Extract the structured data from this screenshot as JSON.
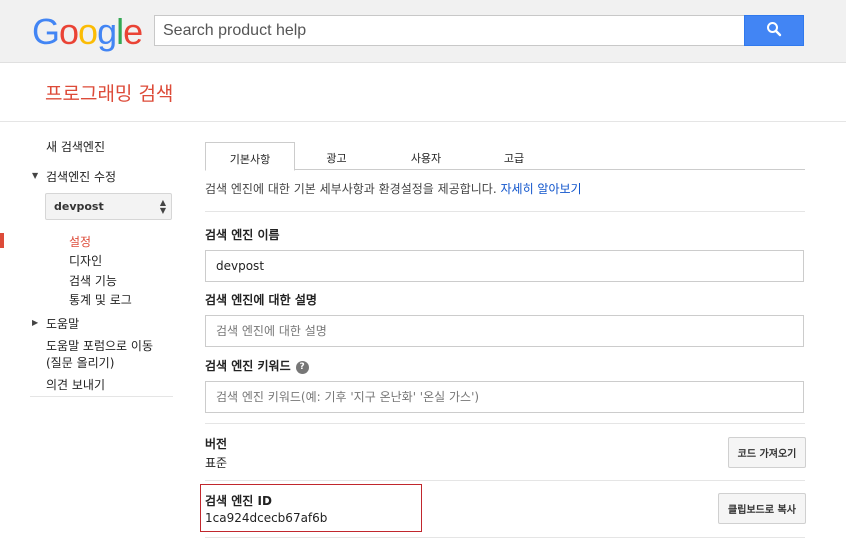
{
  "header": {
    "logo_letters": [
      {
        "ch": "G",
        "color": "#4285f4"
      },
      {
        "ch": "o",
        "color": "#ea4335"
      },
      {
        "ch": "o",
        "color": "#fbbc05"
      },
      {
        "ch": "g",
        "color": "#4285f4"
      },
      {
        "ch": "l",
        "color": "#34a853"
      },
      {
        "ch": "e",
        "color": "#ea4335"
      }
    ],
    "search_placeholder": "Search product help",
    "search_icon": "search-icon"
  },
  "page_title": "프로그래밍 검색",
  "sidebar": {
    "new_engine": "새 검색엔진",
    "edit_engine": "검색엔진 수정",
    "selected_engine": "devpost",
    "sub_items": [
      "설정",
      "디자인",
      "검색 기능",
      "통계 및 로그"
    ],
    "help": "도움말",
    "forum": "도움말 포럼으로 이동",
    "forum_sub": "(질문 올리기)",
    "feedback": "의견 보내기"
  },
  "tabs": [
    "기본사항",
    "광고",
    "사용자",
    "고급"
  ],
  "description": {
    "text": "검색 엔진에 대한 기본 세부사항과 환경설정을 제공합니다.",
    "link": "자세히 알아보기"
  },
  "form": {
    "name_label": "검색 엔진 이름",
    "name_value": "devpost",
    "desc_label": "검색 엔진에 대한 설명",
    "desc_placeholder": "검색 엔진에 대한 설명",
    "keywords_label": "검색 엔진 키워드",
    "keywords_placeholder": "검색 엔진 키워드(예: 기후 '지구 온난화' '온실 가스')",
    "version_label": "버전",
    "version_value": "표준",
    "get_code_button": "코드 가져오기",
    "engine_id_label": "검색 엔진 ID",
    "engine_id_value": "1ca924dcecb67af6b",
    "copy_button": "클립보드로 복사"
  },
  "colors": {
    "accent": "#dd4b39",
    "link": "#1155cc",
    "search_button": "#4285f4",
    "highlight_box": "#c1272d"
  }
}
